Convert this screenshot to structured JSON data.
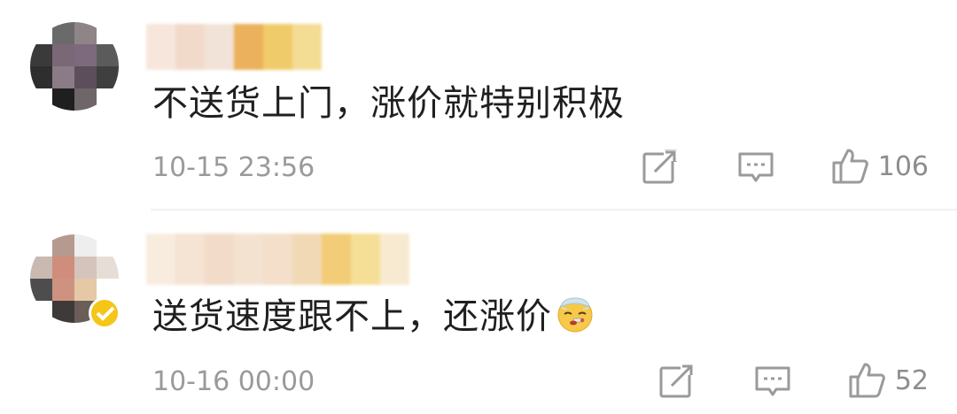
{
  "comments": [
    {
      "text": "不送货上门，涨价就特别积极",
      "time": "10-15 23:56",
      "likes": "106",
      "verified": false,
      "username_colors": [
        "#f6e6dc",
        "#f2dacb",
        "#f1e3d7",
        "#ebb15c",
        "#f0cb6a",
        "#f3dd95"
      ],
      "avatar_colors": [
        "#fff",
        "#6a6a6a",
        "#8f8587",
        "#fff",
        "#3a3a3a",
        "#7a6877",
        "#7d6a7d",
        "#5b5b5b",
        "#2e2e2e",
        "#8a7b86",
        "#5d4e5b",
        "#3f3f3f",
        "#fff",
        "#1f1f1f",
        "#6e6669",
        "#fff"
      ]
    },
    {
      "text": "送货速度跟不上，还涨价",
      "time": "10-16 00:00",
      "likes": "52",
      "verified": true,
      "username_colors": [
        "#f8ecdf",
        "#f5e3d3",
        "#f2dbc8",
        "#f4e2d1",
        "#f3dfca",
        "#f2d9b6",
        "#f2cc76",
        "#f5df97",
        "#f8ead0"
      ],
      "avatar_colors": [
        "#fff",
        "#b69a8f",
        "#eeeeee",
        "#fff",
        "#c9b9b0",
        "#d08d7b",
        "#d4c4bb",
        "#e6ded6",
        "#4d4d4d",
        "#d09280",
        "#e5c9a5",
        "#fff",
        "#fff",
        "#3d3a39",
        "#6b5d57",
        "#fff"
      ]
    }
  ],
  "icons": [
    "share-icon",
    "comment-reply-icon",
    "thumbs-up-icon",
    "verified-badge-icon",
    "thermometer-face-emoji"
  ]
}
